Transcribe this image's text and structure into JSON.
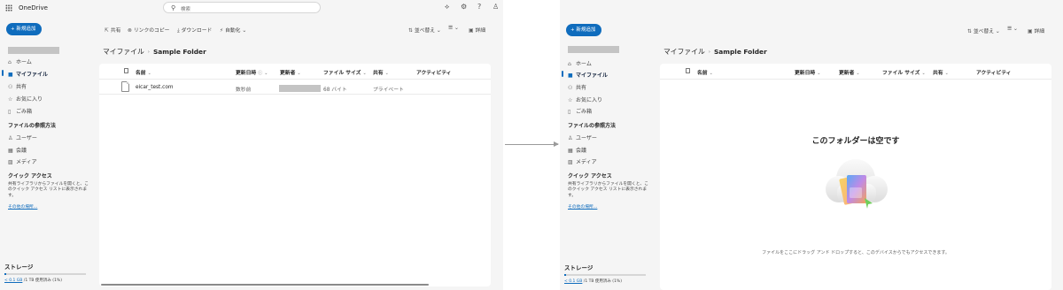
{
  "before": {
    "brand": "OneDrive",
    "search_placeholder": "検索",
    "new_button": "新規追加",
    "toolbar": {
      "share": "共有",
      "copy_link": "リンクのコピー",
      "download": "ダウンロード",
      "automate": "自動化",
      "sort": "並べ替え",
      "details": "詳細"
    },
    "breadcrumb": {
      "root": "マイファイル",
      "current": "Sample Folder"
    },
    "columns": {
      "name": "名前",
      "modified": "更新日時",
      "modified_by": "更新者",
      "file_size": "ファイル サイズ",
      "sharing": "共有",
      "activity": "アクティビティ"
    },
    "rows": [
      {
        "name": "eicar_test.com",
        "modified": "数秒前",
        "size": "68 バイト",
        "sharing": "プライベート"
      }
    ]
  },
  "after": {
    "new_button": "新規追加",
    "toolbar": {
      "sort": "並べ替え",
      "details": "詳細"
    },
    "breadcrumb": {
      "root": "マイファイル",
      "current": "Sample Folder"
    },
    "columns": {
      "name": "名前",
      "modified": "更新日時",
      "modified_by": "更新者",
      "file_size": "ファイル サイズ",
      "sharing": "共有",
      "activity": "アクティビティ"
    },
    "empty_title": "このフォルダーは空です",
    "empty_subtitle": "ファイルをここにドラッグ アンド ドロップすると、このデバイスからでもアクセスできます。"
  },
  "sidebar": {
    "items": [
      {
        "label": "ホーム",
        "icon": "home-icon"
      },
      {
        "label": "マイファイル",
        "icon": "folder-icon"
      },
      {
        "label": "共有",
        "icon": "people-icon"
      },
      {
        "label": "お気に入り",
        "icon": "star-icon"
      },
      {
        "label": "ごみ箱",
        "icon": "trash-icon"
      }
    ],
    "browse_heading": "ファイルの参照方法",
    "browse_items": [
      {
        "label": "ユーザー",
        "icon": "person-icon"
      },
      {
        "label": "会議",
        "icon": "calendar-icon"
      },
      {
        "label": "メディア",
        "icon": "image-icon"
      }
    ],
    "quick_access_heading": "クイック アクセス",
    "quick_access_desc": "共有ライブラリからファイルを開くと、このクイック アクセス リストに表示されます。",
    "more_places": "その他の場所...",
    "storage_title": "ストレージ",
    "storage_used_link": "< 0.1 GB",
    "storage_text": " /1 TB 使用済み (1%)",
    "storage_percent": 1
  },
  "colors": {
    "accent": "#0f6cbd",
    "background": "#f5f5f5",
    "card": "#ffffff"
  }
}
